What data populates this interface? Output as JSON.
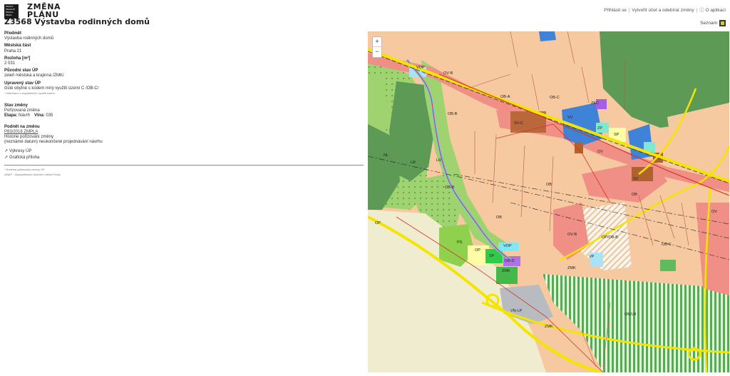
{
  "header": {
    "logo_lines": [
      "PRAHA",
      "PRAGUE",
      "PRAGA",
      "PRAG"
    ],
    "brand_line1": "ZMĚNA",
    "brand_line2": "PLÁNU",
    "title": "Z3568 Výstavba rodinných domů",
    "login": "Přihlásit se",
    "create_account": "Vytvořit účet a odebírat změny",
    "about": "O aplikaci",
    "seznam": "Seznam"
  },
  "detail": {
    "predmet_label": "Předmět",
    "predmet_value": "Výstavba rodinných domů",
    "mestska_cast_label": "Městská část",
    "mestska_cast_value": "Praha 21",
    "rozloha_label": "Rozloha [m²]",
    "rozloha_value": "2 031",
    "puvodni_label": "Původní stav ÚP",
    "puvodni_value": "zeleň městská a krajinná /ZMK/",
    "upraveny_label": "Upravený stav ÚP",
    "upraveny_value": "čisté obytné s kódem míry využití území C /OB-C/",
    "upraveny_note": "* Informace o regulativech využití území",
    "stav_label": "Stav změny",
    "stav_value": "Pořizovaná změna",
    "etapa_label": "Etapa:",
    "etapa_value": "Návrh",
    "vlna_label": "Vlna:",
    "vlna_value": "035",
    "podnet_label": "Podnět na změnu",
    "podnet_value": "P83/2018 ZMPLA",
    "historie_label": "Historie pořizování změny",
    "historie_value": "(neznámé datum) neukončené projednávání návrhu",
    "vykresy_link": "Výkresy ÚP",
    "graficka_link": "Grafická příloha",
    "footnote1": "* Schéma pořizování změny ÚP",
    "footnote2": "ZMAP - Zastupitelstvo hlavního města Prahy"
  },
  "map": {
    "zoom_in": "+",
    "zoom_out": "−",
    "colors": {
      "base": "#f2caa5",
      "residential": "#f6c9a0",
      "mixed": "#ef8f86",
      "green": "#9fd36f",
      "forest": "#5c9a55",
      "park": "#6bb25a",
      "field": "#f0ecd0",
      "water": "#7ec7e8",
      "public": "#3e83d8",
      "yellow_road": "#f4e500",
      "red_line": "#d6322b"
    },
    "labels": [
      "VOP",
      "OV-B",
      "OB-B",
      "OB-A",
      "OB-C",
      "VV",
      "ZKC",
      "ZP",
      "SP",
      "SV-C",
      "OV",
      "SV",
      "OB",
      "NL",
      "LR",
      "PS",
      "OP",
      "VOP",
      "SP",
      "OB-D",
      "ZMK",
      "VP",
      "OP/OB-B",
      "ZMK",
      "OB-C",
      "OB/LR",
      "VN-LP",
      "OP",
      "ZMK",
      "OB",
      "OV-B",
      "LR",
      "OB-B",
      "OB",
      "OV"
    ]
  }
}
